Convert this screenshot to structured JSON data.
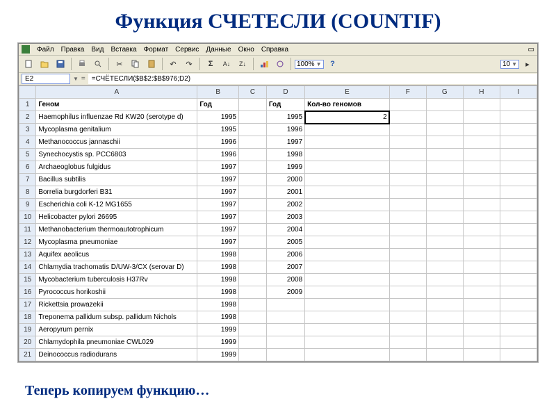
{
  "slide": {
    "title": "Функция СЧЕТЕСЛИ (COUNTIF)",
    "caption": "Теперь копируем функцию…"
  },
  "menu": {
    "file": "Файл",
    "edit": "Правка",
    "view": "Вид",
    "insert": "Вставка",
    "format": "Формат",
    "tools": "Сервис",
    "data": "Данные",
    "window": "Окно",
    "help": "Справка"
  },
  "toolbar": {
    "zoom": "100%",
    "font_size": "10"
  },
  "formula_bar": {
    "cell_ref": "E2",
    "formula": "=СЧЁТЕСЛИ($B$2:$B$976;D2)"
  },
  "columns": [
    "A",
    "B",
    "C",
    "D",
    "E",
    "F",
    "G",
    "H",
    "I"
  ],
  "headers": {
    "A": "Геном",
    "B": "Год",
    "D": "Год",
    "E": "Кол-во геномов"
  },
  "selected_value": "2",
  "rows": [
    {
      "n": 1
    },
    {
      "n": 2,
      "A": "Haemophilus influenzae Rd KW20 (serotype d)",
      "B": 1995,
      "D": 1995
    },
    {
      "n": 3,
      "A": "Mycoplasma genitalium",
      "B": 1995,
      "D": 1996
    },
    {
      "n": 4,
      "A": "Methanococcus jannaschii",
      "B": 1996,
      "D": 1997
    },
    {
      "n": 5,
      "A": "Synechocystis sp. PCC6803",
      "B": 1996,
      "D": 1998
    },
    {
      "n": 6,
      "A": "Archaeoglobus fulgidus",
      "B": 1997,
      "D": 1999
    },
    {
      "n": 7,
      "A": "Bacillus subtilis",
      "B": 1997,
      "D": 2000
    },
    {
      "n": 8,
      "A": "Borrelia burgdorferi B31",
      "B": 1997,
      "D": 2001
    },
    {
      "n": 9,
      "A": "Escherichia coli K-12 MG1655",
      "B": 1997,
      "D": 2002
    },
    {
      "n": 10,
      "A": "Helicobacter pylori 26695",
      "B": 1997,
      "D": 2003
    },
    {
      "n": 11,
      "A": "Methanobacterium thermoautotrophicum",
      "B": 1997,
      "D": 2004
    },
    {
      "n": 12,
      "A": "Mycoplasma pneumoniae",
      "B": 1997,
      "D": 2005
    },
    {
      "n": 13,
      "A": "Aquifex aeolicus",
      "B": 1998,
      "D": 2006
    },
    {
      "n": 14,
      "A": "Chlamydia trachomatis D/UW-3/CX (serovar D)",
      "B": 1998,
      "D": 2007
    },
    {
      "n": 15,
      "A": "Mycobacterium tuberculosis H37Rv",
      "B": 1998,
      "D": 2008
    },
    {
      "n": 16,
      "A": "Pyrococcus horikoshii",
      "B": 1998,
      "D": 2009
    },
    {
      "n": 17,
      "A": "Rickettsia prowazekii",
      "B": 1998
    },
    {
      "n": 18,
      "A": "Treponema pallidum subsp. pallidum Nichols",
      "B": 1998
    },
    {
      "n": 19,
      "A": "Aeropyrum pernix",
      "B": 1999
    },
    {
      "n": 20,
      "A": "Chlamydophila pneumoniae CWL029",
      "B": 1999
    },
    {
      "n": 21,
      "A": "Deinococcus radiodurans",
      "B": 1999
    }
  ]
}
